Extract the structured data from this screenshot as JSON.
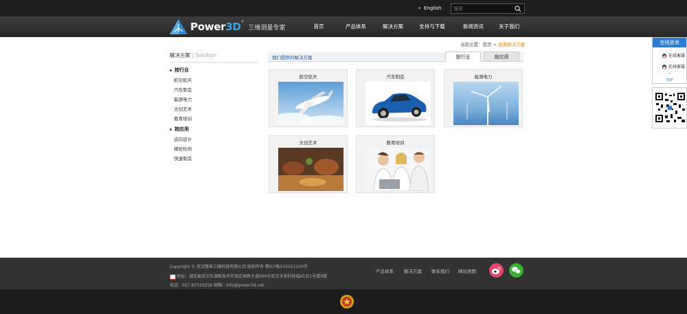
{
  "header": {
    "english_label": "English",
    "search_placeholder": "搜索",
    "logo_brand_main": "Power",
    "logo_brand_3d": "3D",
    "logo_reg": "®",
    "slogan": "三维测量专家",
    "nav": [
      "首页",
      "产品体系",
      "解决方案",
      "支持与下载",
      "新闻资讯",
      "关于我们"
    ]
  },
  "breadcrumb": {
    "prefix": "当前位置：",
    "home": "首页",
    "sep": " > ",
    "current": "经典解决方案"
  },
  "sidebar": {
    "title": "解决方案",
    "title_sep": " | ",
    "title_en": "Solution",
    "group1": "按行业",
    "group1_items": [
      "航空航天",
      "汽车制造",
      "能源电力",
      "文创艺术",
      "教育培训"
    ],
    "group2": "按应用",
    "group2_items": [
      "逆向设计",
      "精密检测",
      "快速制造"
    ]
  },
  "content": {
    "heading": "我们提供的解决方案",
    "tabs": [
      "按行业",
      "按应用"
    ],
    "cards": [
      "航空航天",
      "汽车制造",
      "能源电力",
      "文创艺术",
      "教育培训"
    ]
  },
  "widget": {
    "title": "在线咨询",
    "qq_items": [
      "在线客服",
      "在线客服"
    ],
    "top_label": "TOP"
  },
  "footer": {
    "copyright": "Copyright © 武汉惟景三维科技有限公司 版权所有 鄂ICP备015021200号",
    "address": "地址：湖北省武汉东湖新技术开发区高新大道999号武汉未来科技城A5北1号楼9楼",
    "contact": "电话：027-87550256 邮箱：info@power3d.net",
    "links": [
      "产品体系",
      "解决方案",
      "联系我们",
      "网站地图"
    ]
  },
  "colors": {
    "accent_blue": "#2d7dd2",
    "brand_3d": "#3fa2e0",
    "breadcrumb_current": "#e08a1e",
    "weibo": "#e6486b",
    "wechat": "#3cb034"
  }
}
